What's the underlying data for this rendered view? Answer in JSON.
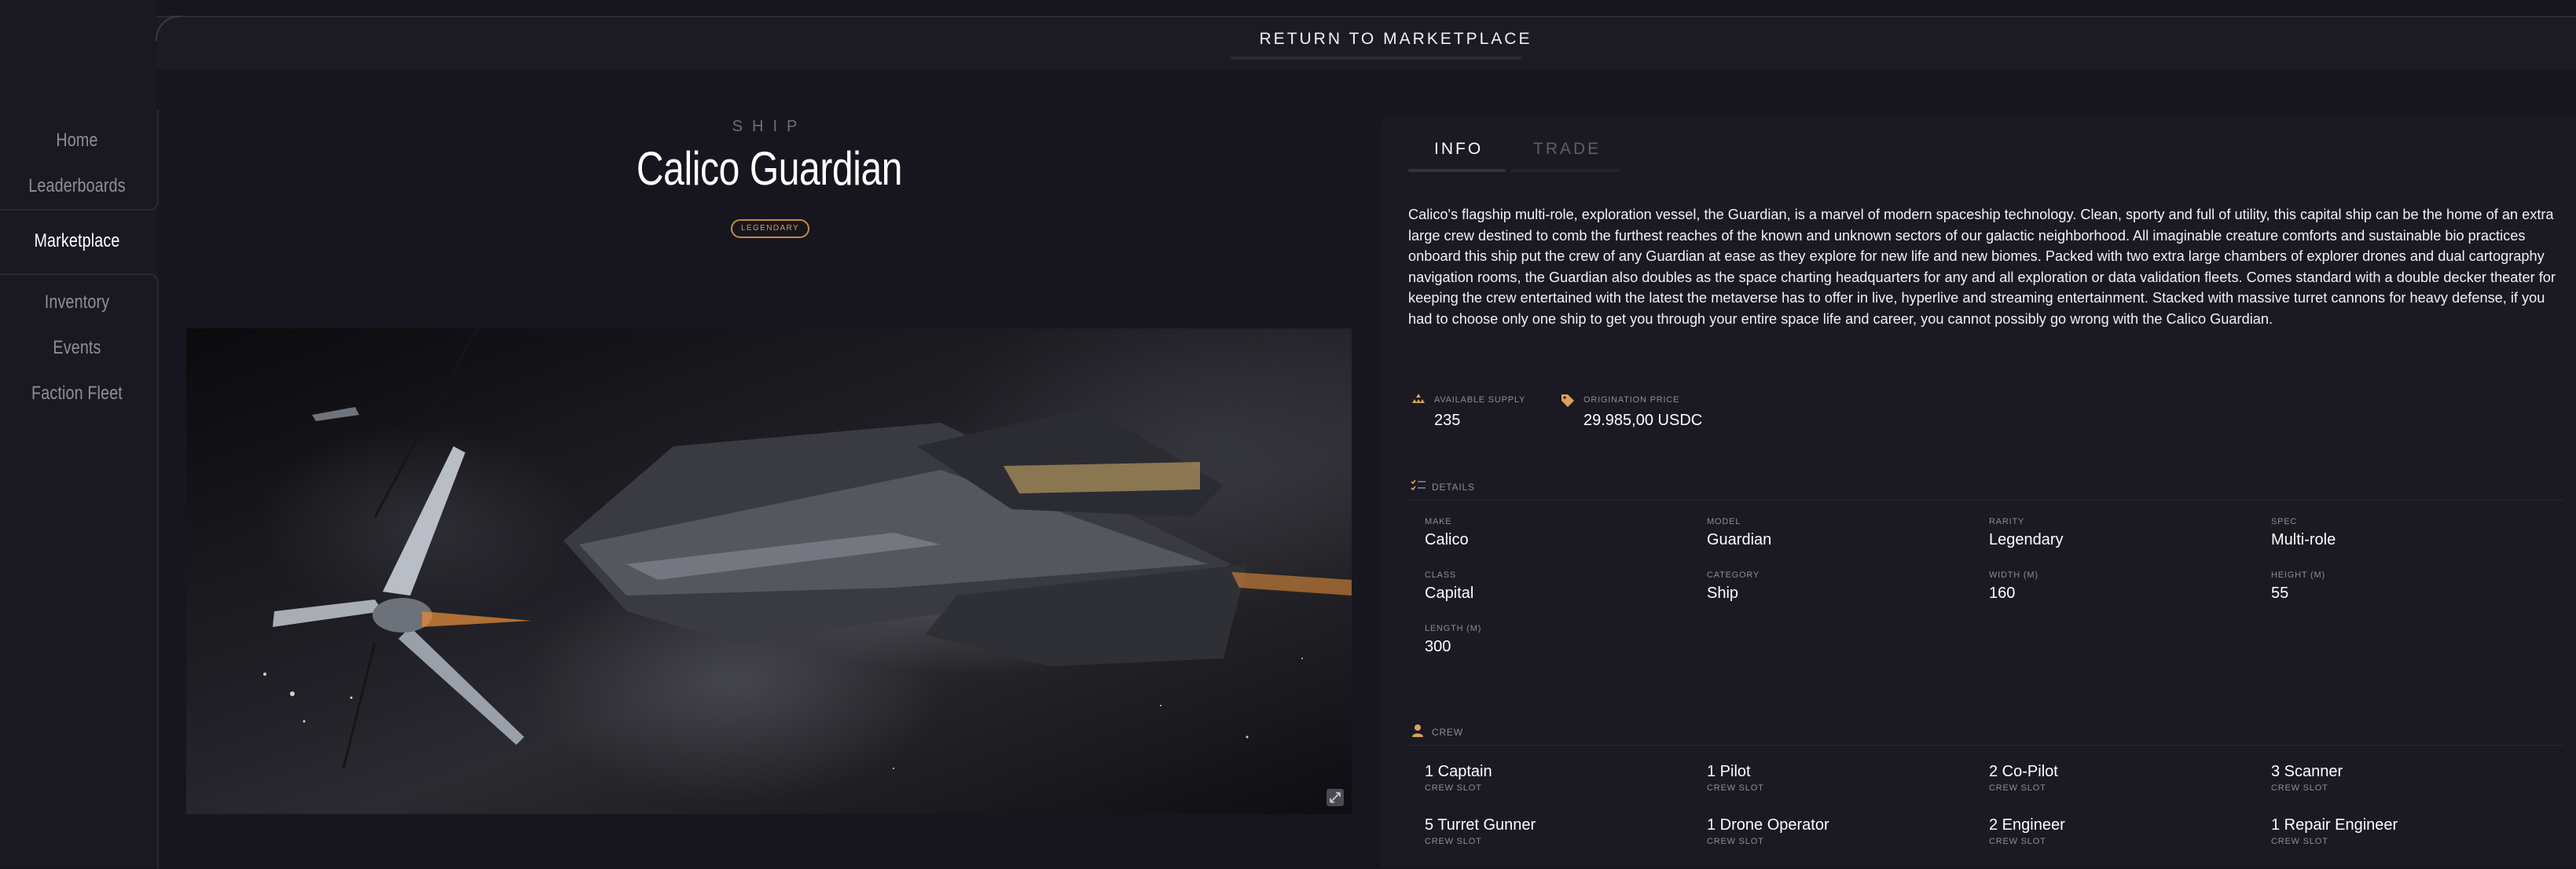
{
  "sidebar": {
    "items": [
      {
        "label": "Home"
      },
      {
        "label": "Leaderboards"
      },
      {
        "label": "Marketplace"
      },
      {
        "label": "Inventory"
      },
      {
        "label": "Events"
      },
      {
        "label": "Faction Fleet"
      }
    ],
    "active": "Marketplace"
  },
  "header": {
    "return_label": "RETURN TO MARKETPLACE"
  },
  "ship": {
    "kicker": "SHIP",
    "name": "Calico Guardian",
    "rarity": "LEGENDARY",
    "image_icon": "expand-icon"
  },
  "tabs": {
    "info": "INFO",
    "trade": "TRADE",
    "active": "INFO"
  },
  "info": {
    "description": "Calico's flagship multi-role, exploration vessel, the Guardian, is a marvel of modern spaceship technology. Clean, sporty and full of utility, this capital ship can be the home of an extra large crew destined to comb the furthest reaches of the known and unknown sectors of our galactic neighborhood. All imaginable creature comforts and sustainable bio practices onboard this ship put the crew of any Guardian at ease as they explore for new life and new biomes. Packed with two extra large chambers of explorer drones and dual cartography navigation rooms, the Guardian also doubles as the space charting headquarters for any and all exploration or data validation fleets. Comes standard with a double decker theater for keeping the crew entertained with the latest the metaverse has to offer in live, hyperlive and streaming entertainment. Stacked with massive turret cannons for heavy defense, if you had to choose only one ship to get you through your entire space life and career, you cannot possibly go wrong with the Calico Guardian.",
    "supply": {
      "label": "AVAILABLE SUPPLY",
      "value": "235"
    },
    "price": {
      "label": "ORIGINATION PRICE",
      "value": "29.985,00 USDC"
    },
    "details_label": "DETAILS",
    "details": [
      {
        "label": "MAKE",
        "value": "Calico"
      },
      {
        "label": "MODEL",
        "value": "Guardian"
      },
      {
        "label": "RARITY",
        "value": "Legendary"
      },
      {
        "label": "SPEC",
        "value": "Multi-role"
      },
      {
        "label": "CLASS",
        "value": "Capital"
      },
      {
        "label": "CATEGORY",
        "value": "Ship"
      },
      {
        "label": "WIDTH (M)",
        "value": "160"
      },
      {
        "label": "HEIGHT (M)",
        "value": "55"
      },
      {
        "label": "LENGTH (M)",
        "value": "300"
      }
    ],
    "crew_label": "CREW",
    "crew": [
      {
        "value": "1 Captain",
        "label": "CREW SLOT"
      },
      {
        "value": "1 Pilot",
        "label": "CREW SLOT"
      },
      {
        "value": "2 Co-Pilot",
        "label": "CREW SLOT"
      },
      {
        "value": "3 Scanner",
        "label": "CREW SLOT"
      },
      {
        "value": "5 Turret Gunner",
        "label": "CREW SLOT"
      },
      {
        "value": "1 Drone Operator",
        "label": "CREW SLOT"
      },
      {
        "value": "2 Engineer",
        "label": "CREW SLOT"
      },
      {
        "value": "1 Repair Engineer",
        "label": "CREW SLOT"
      }
    ]
  },
  "colors": {
    "background": "#17161f",
    "panel": "#1b1a23",
    "accent_legendary": "#c58a3c",
    "icon_gold": "#d9a35b"
  }
}
